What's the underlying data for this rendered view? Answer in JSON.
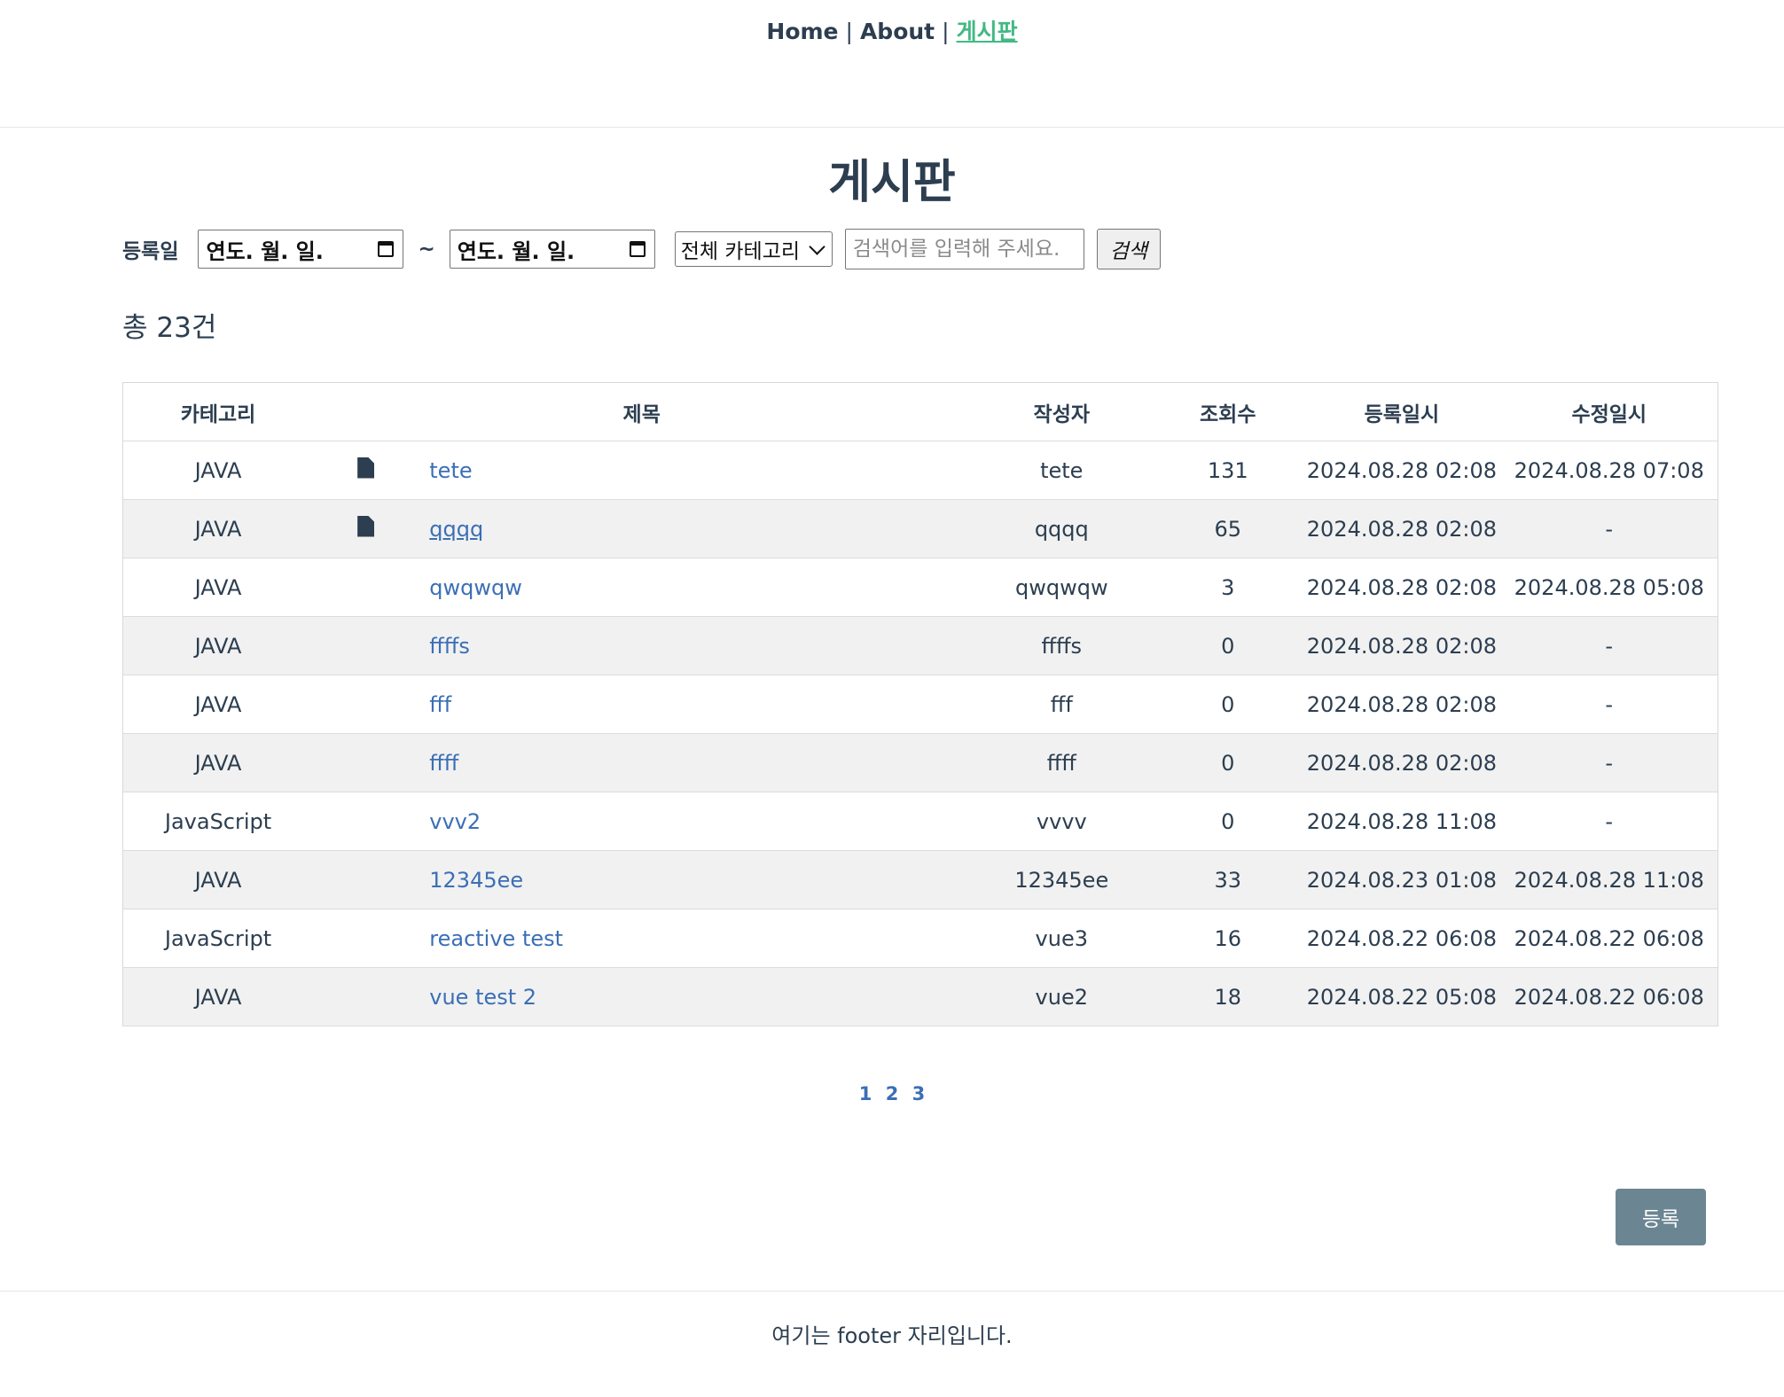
{
  "nav": {
    "home": "Home",
    "about": "About",
    "board": "게시판",
    "separator": "|"
  },
  "page": {
    "title": "게시판"
  },
  "search": {
    "date_label": "등록일",
    "start_date_text": "연도. 월. 일.",
    "end_date_text": "연도. 월. 일.",
    "range_separator": "~",
    "category_selected": "전체 카테고리",
    "keyword_placeholder": "검색어를 입력해 주세요.",
    "keyword_value": "",
    "button_label": "검색"
  },
  "summary": {
    "total_text": "총 23건"
  },
  "table": {
    "columns": [
      "카테고리",
      "제목",
      "작성자",
      "조회수",
      "등록일시",
      "수정일시"
    ],
    "rows": [
      {
        "category": "JAVA",
        "has_file": true,
        "title": "tete",
        "author": "tete",
        "views": "131",
        "created": "2024.08.28 02:08",
        "modified": "2024.08.28 07:08"
      },
      {
        "category": "JAVA",
        "has_file": true,
        "title": "qqqq",
        "author": "qqqq",
        "views": "65",
        "created": "2024.08.28 02:08",
        "modified": "-"
      },
      {
        "category": "JAVA",
        "has_file": false,
        "title": "qwqwqw",
        "author": "qwqwqw",
        "views": "3",
        "created": "2024.08.28 02:08",
        "modified": "2024.08.28 05:08"
      },
      {
        "category": "JAVA",
        "has_file": false,
        "title": "ffffs",
        "author": "ffffs",
        "views": "0",
        "created": "2024.08.28 02:08",
        "modified": "-"
      },
      {
        "category": "JAVA",
        "has_file": false,
        "title": "fff",
        "author": "fff",
        "views": "0",
        "created": "2024.08.28 02:08",
        "modified": "-"
      },
      {
        "category": "JAVA",
        "has_file": false,
        "title": "ffff",
        "author": "ffff",
        "views": "0",
        "created": "2024.08.28 02:08",
        "modified": "-"
      },
      {
        "category": "JavaScript",
        "has_file": false,
        "title": "vvv2",
        "author": "vvvv",
        "views": "0",
        "created": "2024.08.28 11:08",
        "modified": "-"
      },
      {
        "category": "JAVA",
        "has_file": false,
        "title": "12345ee",
        "author": "12345ee",
        "views": "33",
        "created": "2024.08.23 01:08",
        "modified": "2024.08.28 11:08"
      },
      {
        "category": "JavaScript",
        "has_file": false,
        "title": "reactive test",
        "author": "vue3",
        "views": "16",
        "created": "2024.08.22 06:08",
        "modified": "2024.08.22 06:08"
      },
      {
        "category": "JAVA",
        "has_file": false,
        "title": "vue test 2",
        "author": "vue2",
        "views": "18",
        "created": "2024.08.22 05:08",
        "modified": "2024.08.22 06:08"
      }
    ]
  },
  "pagination": {
    "pages": [
      "1",
      "2",
      "3"
    ]
  },
  "actions": {
    "register_label": "등록"
  },
  "footer": {
    "text": "여기는 footer 자리입니다."
  },
  "colors": {
    "text": "#2c3e50",
    "active_link": "#42b983",
    "link": "#3b6fb6",
    "register_button": "#6c8593",
    "row_stripe": "#f1f1f1"
  }
}
